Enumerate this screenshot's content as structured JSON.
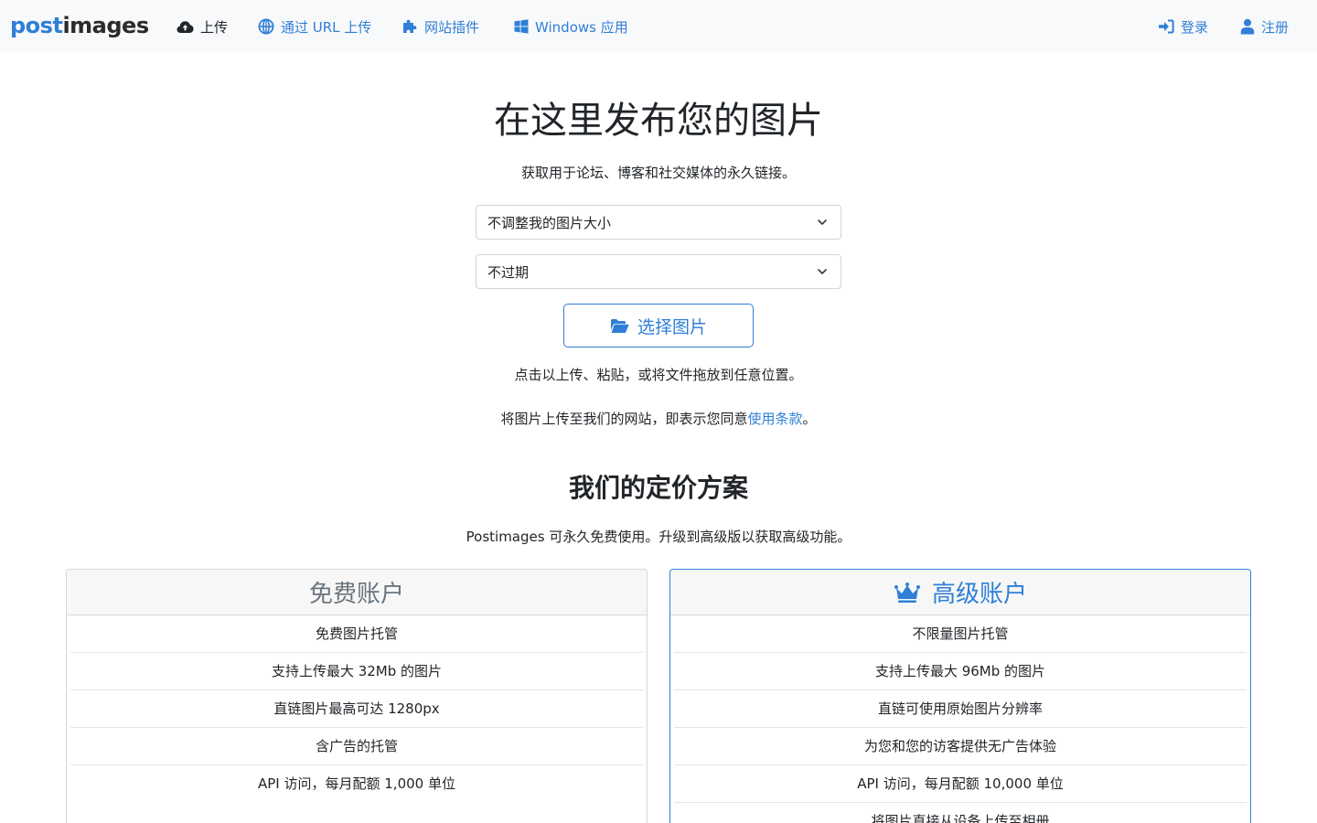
{
  "brand": {
    "post": "post",
    "images": "images"
  },
  "nav": {
    "upload": "上传",
    "url_upload": "通过 URL 上传",
    "plugins": "网站插件",
    "windows": "Windows 应用",
    "login": "登录",
    "register": "注册"
  },
  "hero": {
    "title": "在这里发布您的图片",
    "subtitle": "获取用于论坛、博客和社交媒体的永久链接。",
    "resize_select": "不调整我的图片大小",
    "expire_select": "不过期",
    "choose_button": "选择图片",
    "drop_hint": "点击以上传、粘贴，或将文件拖放到任意位置。",
    "terms_prefix": "将图片上传至我们的网站，即表示您同意",
    "terms_link": "使用条款",
    "terms_suffix": "。"
  },
  "pricing": {
    "title": "我们的定价方案",
    "subtitle": "Postimages 可永久免费使用。升级到高级版以获取高级功能。",
    "free": {
      "title": "免费账户",
      "features": [
        "免费图片托管",
        "支持上传最大 32Mb 的图片",
        "直链图片最高可达 1280px",
        "含广告的托管",
        "API 访问，每月配额 1,000 单位"
      ]
    },
    "premium": {
      "title": "高级账户",
      "features": [
        "不限量图片托管",
        "支持上传最大 96Mb 的图片",
        "直链可使用原始图片分辨率",
        "为您和您的访客提供无广告体验",
        "API 访问，每月配额 10,000 单位",
        "将图片直接从设备上传至相册"
      ]
    }
  },
  "colors": {
    "accent": "#2f7fd6",
    "navbar_bg": "#f8f9fa",
    "text": "#212529",
    "muted": "#6c757d"
  },
  "icons": [
    "cloud-upload-icon",
    "globe-icon",
    "puzzle-icon",
    "windows-icon",
    "sign-in-icon",
    "user-icon",
    "chevron-down-icon",
    "folder-open-icon",
    "crown-icon"
  ]
}
